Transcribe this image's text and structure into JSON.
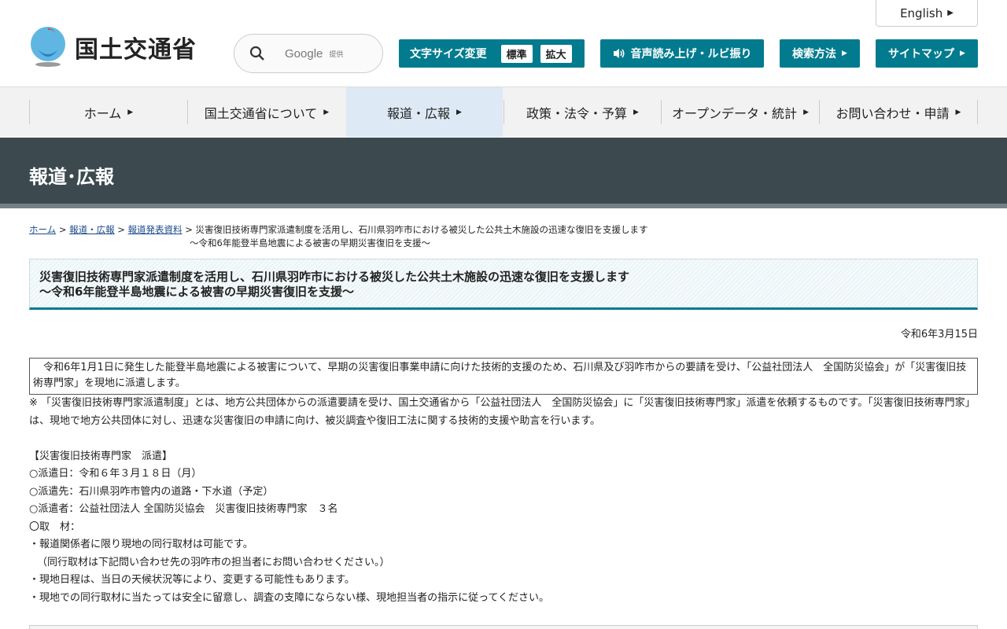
{
  "header": {
    "logo_text": "国土交通省",
    "english_label": "English",
    "search": {
      "provider": "Google",
      "provider_note": "提供"
    },
    "font_size": {
      "label": "文字サイズ変更",
      "options": [
        "標準",
        "拡大"
      ]
    },
    "voice_label": "音声読み上げ・ルビ振り",
    "search_method_label": "検索方法",
    "sitemap_label": "サイトマップ",
    "accent_color": "#037b8f"
  },
  "gnav": {
    "items": [
      {
        "label": "ホーム"
      },
      {
        "label": "国土交通省について"
      },
      {
        "label": "報道・広報"
      },
      {
        "label": "政策・法令・予算"
      },
      {
        "label": "オープンデータ・統計"
      },
      {
        "label": "お問い合わせ・申請"
      }
    ],
    "active_index": 2
  },
  "page": {
    "section_title": "報道･広報"
  },
  "breadcrumb": {
    "items": [
      "ホーム",
      "報道・広報",
      "報道発表資料"
    ],
    "current": "災害復旧技術専門家派遣制度を活用し、石川県羽咋市における被災した公共土木施設の迅速な復旧を支援します",
    "current_sub": "～令和6年能登半島地震による被害の早期災害復旧を支援～",
    "separator": ">"
  },
  "article": {
    "title_line1": "災害復旧技術専門家派遣制度を活用し、石川県羽咋市における被災した公共土木施設の迅速な復旧を支援します",
    "title_line2": "～令和6年能登半島地震による被害の早期災害復旧を支援～",
    "date": "令和6年3月15日",
    "lead": "　令和6年1月1日に発生した能登半島地震による被害について、早期の災害復旧事業申請に向けた技術的支援のため、石川県及び羽咋市からの要請を受け、「公益社団法人　全国防災協会」が「災害復旧技術専門家」を現地に派遣します。",
    "note": "※ 「災害復旧技術専門家派遣制度」とは、地方公共団体からの派遣要請を受け、国土交通省から「公益社団法人　全国防災協会」に「災害復旧技術専門家」派遣を依頼するものです。「災害復旧技術専門家」は、現地で地方公共団体に対し、迅速な災害復旧の申請に向け、被災調査や復旧工法に関する技術的支援や助言を行います。",
    "section_heading": "【災害復旧技術専門家　派遣】",
    "details": [
      "○派遣日：令和６年３月１８日（月）",
      "○派遣先：石川県羽咋市管内の道路・下水道（予定）",
      "○派遣者：公益社団法人 全国防災協会　災害復旧技術専門家　３名",
      "〇取　材：",
      "・報道関係者に限り現地の同行取材は可能です。",
      "（同行取材は下記問い合わせ先の羽咋市の担当者にお問い合わせください。）",
      "・現地日程は、当日の天候状況等により、変更する可能性もあります。",
      "・現地での同行取材に当たっては安全に留意し、調査の支障にならない様、現地担当者の指示に従ってください。"
    ]
  }
}
